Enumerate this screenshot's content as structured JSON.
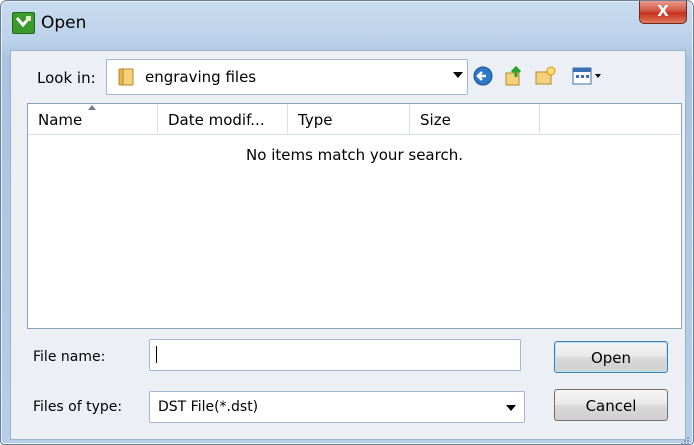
{
  "window": {
    "title": "Open",
    "close_label": "X"
  },
  "toolbar": {
    "look_in_label": "Look in:",
    "look_in_value": "engraving files"
  },
  "file_list": {
    "columns": [
      "Name",
      "Date modif...",
      "Type",
      "Size"
    ],
    "empty_message": "No items match your search."
  },
  "form": {
    "file_name_label": "File name:",
    "file_name_value": "",
    "files_of_type_label": "Files of type:",
    "files_of_type_value": "DST File(*.dst)"
  },
  "buttons": {
    "open": "Open",
    "cancel": "Cancel"
  },
  "colors": {
    "title_bar": "#bcd2ea",
    "close_button": "#c4301a",
    "accent": "#3c7fb1"
  },
  "icons": [
    "app-icon",
    "folder-icon",
    "back-icon",
    "up-folder-icon",
    "new-folder-icon",
    "views-icon",
    "close-icon"
  ]
}
